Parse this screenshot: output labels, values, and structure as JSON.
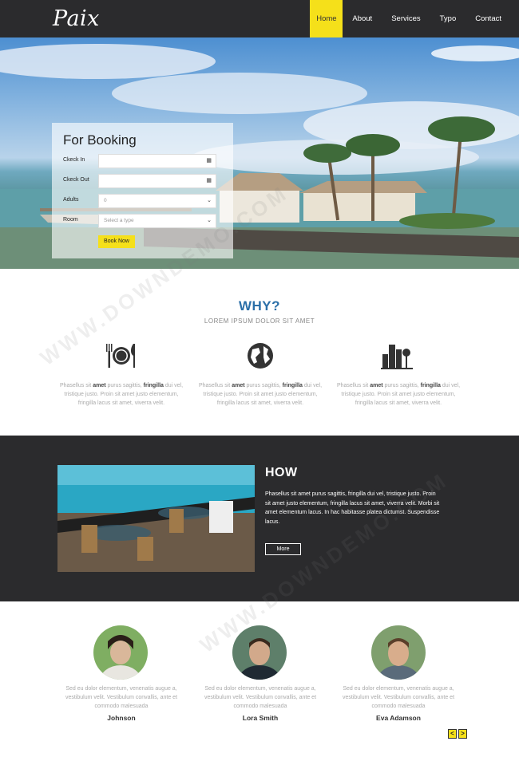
{
  "nav": {
    "logo": "Paix",
    "items": [
      {
        "label": "Home",
        "active": true
      },
      {
        "label": "About",
        "active": false
      },
      {
        "label": "Services",
        "active": false
      },
      {
        "label": "Typo",
        "active": false
      },
      {
        "label": "Contact",
        "active": false
      }
    ]
  },
  "booking": {
    "title": "For Booking",
    "fields": [
      {
        "label": "Ckeck In",
        "value": "",
        "icon": "calendar-icon"
      },
      {
        "label": "Ckeck Out",
        "value": "",
        "icon": "calendar-icon"
      },
      {
        "label": "Adults",
        "value": "0",
        "icon": "chevron-down-icon"
      },
      {
        "label": "Room",
        "value": "Select a type",
        "icon": "chevron-down-icon"
      }
    ],
    "button": "Book Now"
  },
  "why": {
    "title": "WHY?",
    "subtitle": "LOREM IPSUM DOLOR SIT AMET",
    "features": [
      {
        "icon": "restaurant-icon",
        "t1": "Phasellus sit ",
        "b1": "amet",
        "t2": " purus sagittis, ",
        "b2": "fringilla",
        "t3": " dui vel, tristique justo. Proin sit amet justo elementum, fringilla lacus sit amet, viverra velit."
      },
      {
        "icon": "globe-icon",
        "t1": "Phasellus sit ",
        "b1": "amet",
        "t2": " purus sagittis, ",
        "b2": "fringilla",
        "t3": " dui vel, tristique justo. Proin sit amet justo elementum, fringilla lacus sit amet, viverra velit."
      },
      {
        "icon": "city-icon",
        "t1": "Phasellus sit ",
        "b1": "amet",
        "t2": " purus sagittis, ",
        "b2": "fringilla",
        "t3": " dui vel, tristique justo. Proin sit amet justo elementum, fringilla lacus sit amet, viverra velit."
      }
    ]
  },
  "how": {
    "title": "HOW",
    "text": "Phasellus sit amet purus sagittis, fringilla dui vel, tristique justo. Proin sit amet justo elementum, fringilla lacus sit amet, viverra velit. Morbi sit amet elementum lacus. In hac habitasse platea dictumst. Suspendisse lacus.",
    "button": "More"
  },
  "team": {
    "members": [
      {
        "name": "Johnson",
        "text": "Sed eu dolor elementum, venenatis augue a, vestibulum velit. Vestibulum convallis, ante et commodo malesuada"
      },
      {
        "name": "Lora Smith",
        "text": "Sed eu dolor elementum, venenatis augue a, vestibulum velit. Vestibulum convallis, ante et commodo malesuada"
      },
      {
        "name": "Eva Adamson",
        "text": "Sed eu dolor elementum, venenatis augue a, vestibulum velit. Vestibulum convallis, ante et commodo malesuada"
      }
    ],
    "prev": "<",
    "next": ">"
  },
  "watermark": "WWW.DOWNDEMO.COM",
  "colors": {
    "accent": "#f5e01a",
    "dark": "#2b2b2d",
    "blue": "#2b6fa8"
  }
}
